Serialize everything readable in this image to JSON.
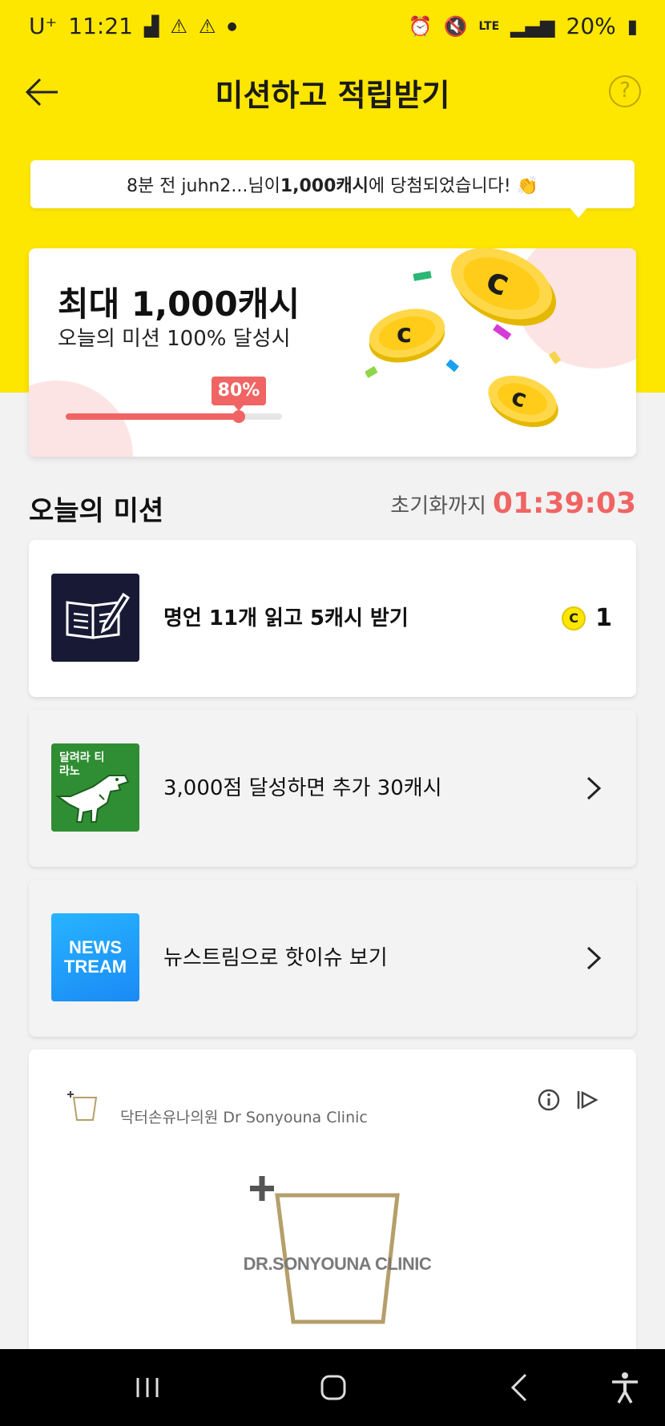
{
  "status_bar": {
    "carrier": "U⁺",
    "time": "11:21",
    "network": "LTE",
    "battery": "20%"
  },
  "header": {
    "title": "미션하고 적립받기"
  },
  "toast": {
    "prefix": "8분 전 juhn2...님이 ",
    "amount": "1,000캐시",
    "suffix": "에 당첨되었습니다! 👏"
  },
  "reward_card": {
    "title": "최대 1,000캐시",
    "subtitle": "오늘의 미션 100% 달성시",
    "progress_label": "80%",
    "progress": 0.8
  },
  "missions_section": {
    "heading": "오늘의 미션",
    "reset_label": "초기화까지",
    "reset_timer": "01:39:03"
  },
  "missions": [
    {
      "text": "명언 11개 읽고 5캐시 받기",
      "reward": "1",
      "coin_label": "C",
      "icon": "book-pen-icon"
    },
    {
      "text": "3,000점 달성하면 추가 30캐시",
      "thumb_text": "달려라 티라노",
      "icon": "tyranno-game-icon"
    },
    {
      "text": "뉴스트림으로 핫이슈 보기",
      "logo_line1": "NEWS",
      "logo_line2": "TREAM",
      "icon": "newstream-logo"
    }
  ],
  "ad": {
    "name": "닥터손유나의원 Dr Sonyouna Clinic",
    "brand": "DR.SONYOUNA CLINIC"
  },
  "colors": {
    "brand_yellow": "#fde600",
    "accent_red": "#f06463"
  }
}
